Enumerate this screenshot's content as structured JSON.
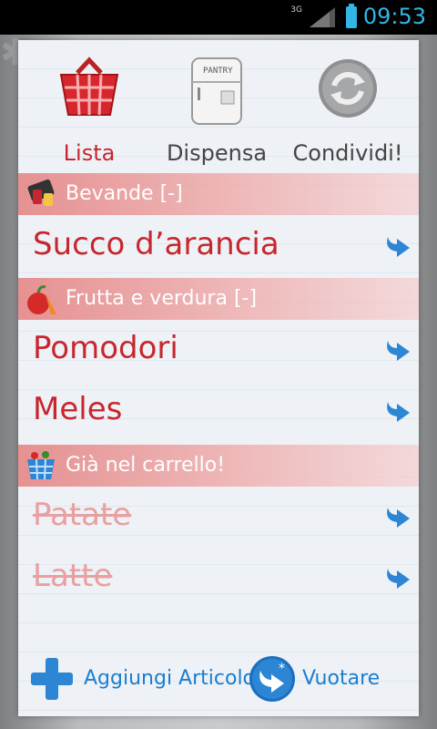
{
  "status_bar": {
    "network": "3G",
    "time": "09:53"
  },
  "tabs": [
    {
      "label": "Lista",
      "icon": "basket-icon"
    },
    {
      "label": "Dispensa",
      "icon": "pantry-fridge-icon"
    },
    {
      "label": "Condividi!",
      "icon": "sync-icon"
    }
  ],
  "sections": [
    {
      "label": "Bevande [-]",
      "icon": "drinks-icon"
    },
    {
      "label": "Frutta e verdura [-]",
      "icon": "fruit-vegetables-icon"
    },
    {
      "label": "Già nel carrello!",
      "icon": "cart-icon"
    }
  ],
  "items": [
    {
      "label": "Succo d’arancia",
      "section": "Bevande",
      "done": false
    },
    {
      "label": "Pomodori",
      "section": "Frutta e verdura",
      "done": false
    },
    {
      "label": "Meles",
      "section": "Frutta e verdura",
      "done": false
    },
    {
      "label": "Patate",
      "section": "Già nel carrello!",
      "done": true
    },
    {
      "label": "Latte",
      "section": "Già nel carrello!",
      "done": true
    }
  ],
  "bottom": {
    "add_label": "Aggiungi Articolo",
    "empty_label": "Vuotare"
  },
  "fridge_text": "PANTRY",
  "colors": {
    "accent_red": "#c8262e",
    "link_blue": "#1a7fd0",
    "status_blue": "#33b5e5"
  }
}
